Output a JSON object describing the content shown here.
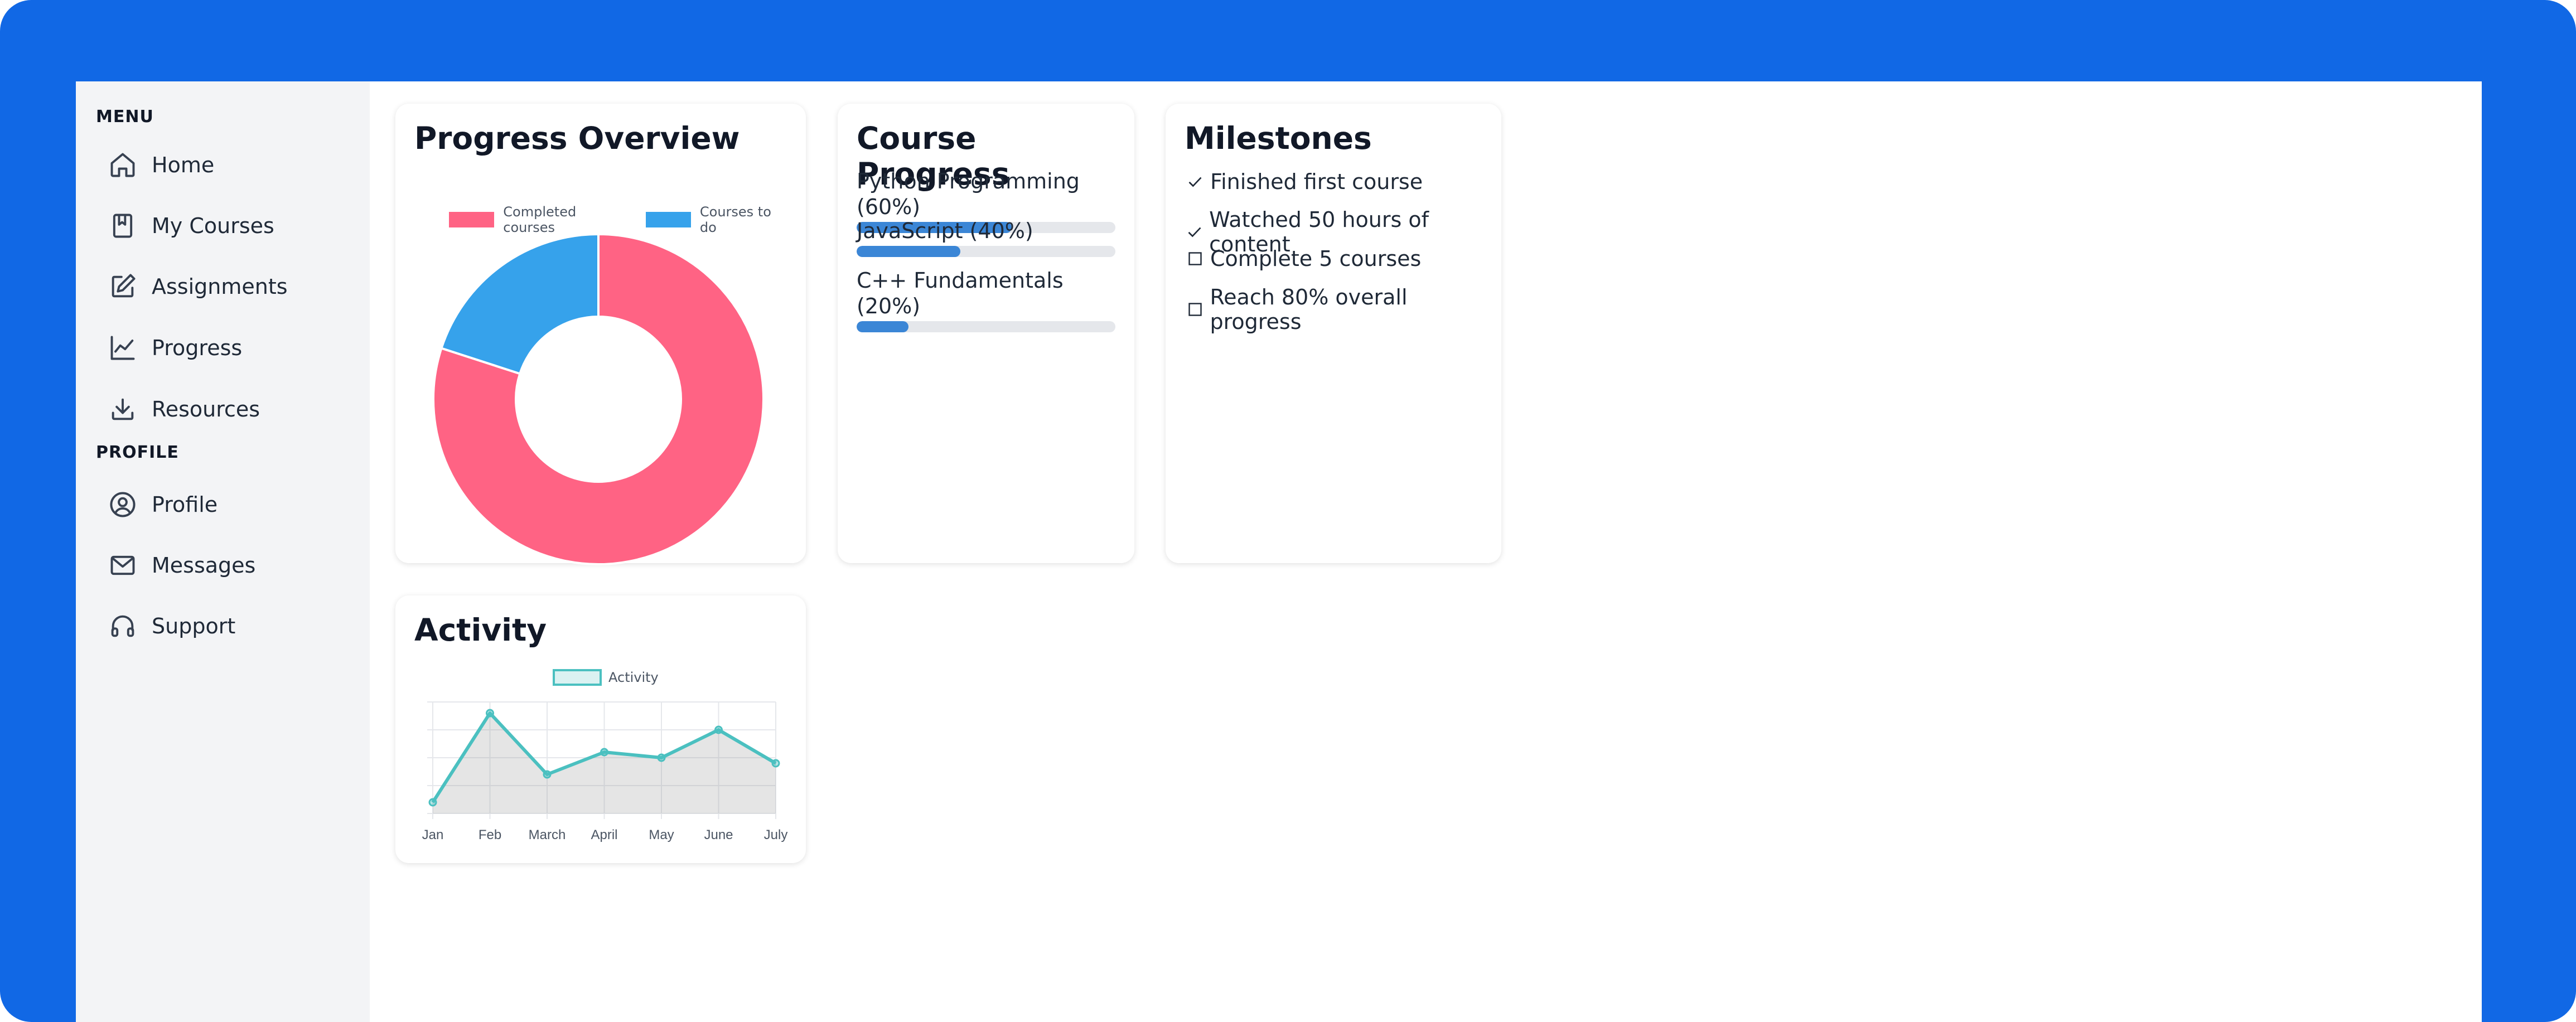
{
  "sidebar": {
    "menu_label": "MENU",
    "profile_label": "PROFILE",
    "menu_items": [
      {
        "label": "Home",
        "icon": "home-icon"
      },
      {
        "label": "My Courses",
        "icon": "book-icon"
      },
      {
        "label": "Assignments",
        "icon": "edit-icon"
      },
      {
        "label": "Progress",
        "icon": "chart-line-icon"
      },
      {
        "label": "Resources",
        "icon": "download-icon"
      }
    ],
    "profile_items": [
      {
        "label": "Profile",
        "icon": "user-circle-icon"
      },
      {
        "label": "Messages",
        "icon": "mail-icon"
      },
      {
        "label": "Support",
        "icon": "headphones-icon"
      }
    ]
  },
  "progress_overview": {
    "title": "Progress Overview",
    "legend": [
      "Completed courses",
      "Courses to do"
    ],
    "colors": [
      "#ff6384",
      "#36a2eb"
    ]
  },
  "course_progress": {
    "title": "Course Progress",
    "courses": [
      {
        "label": "Python Programming (60%)",
        "progress": 0.6
      },
      {
        "label": "JavaScript (40%)",
        "progress": 0.4
      },
      {
        "label": "C++ Fundamentals (20%)",
        "progress": 0.2
      }
    ]
  },
  "milestones": {
    "title": "Milestones",
    "items": [
      {
        "text": "Finished first course",
        "done": true
      },
      {
        "text": "Watched 50 hours of content",
        "done": true
      },
      {
        "text": "Complete 5 courses",
        "done": false
      },
      {
        "text": "Reach 80% overall progress",
        "done": false
      }
    ]
  },
  "activity": {
    "title": "Activity",
    "legend": "Activity",
    "color": "#4bc0c0"
  },
  "chart_data": [
    {
      "type": "pie",
      "variant": "doughnut",
      "categories": [
        "Completed courses",
        "Courses to do"
      ],
      "values": [
        80,
        20
      ],
      "colors": [
        "#ff6384",
        "#36a2eb"
      ],
      "legend": "top"
    },
    {
      "type": "area",
      "categories": [
        "Jan",
        "Feb",
        "March",
        "April",
        "May",
        "June",
        "July"
      ],
      "series": [
        {
          "name": "Activity",
          "values": [
            2,
            18,
            7,
            11,
            10,
            15,
            9
          ]
        }
      ],
      "ylim": [
        0,
        20
      ],
      "grid": true,
      "legend": "top",
      "color": "#4bc0c0"
    }
  ]
}
